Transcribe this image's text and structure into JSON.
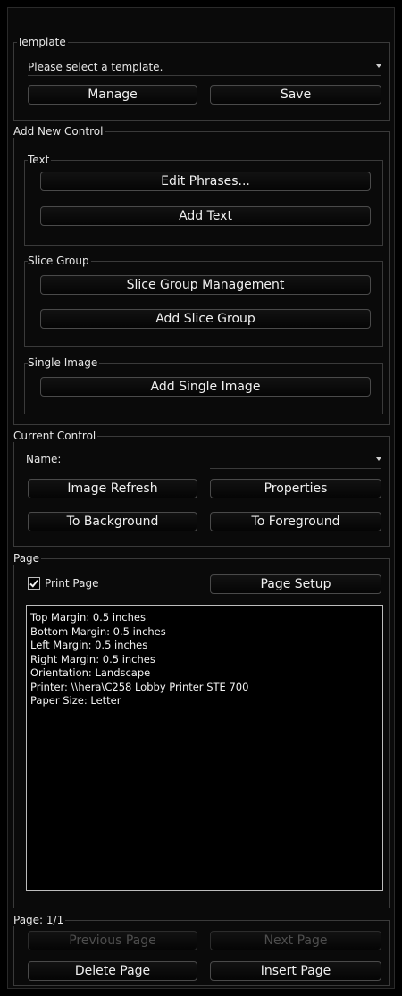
{
  "template": {
    "legend": "Template",
    "select_value": "Please select a template.",
    "manage_label": "Manage",
    "save_label": "Save"
  },
  "add_new_control": {
    "legend": "Add New Control",
    "text": {
      "legend": "Text",
      "edit_phrases_label": "Edit Phrases...",
      "add_text_label": "Add Text"
    },
    "slice_group": {
      "legend": "Slice Group",
      "management_label": "Slice Group Management",
      "add_label": "Add Slice Group"
    },
    "single_image": {
      "legend": "Single Image",
      "add_label": "Add Single Image"
    }
  },
  "current_control": {
    "legend": "Current Control",
    "name_label": "Name:",
    "name_value": "",
    "image_refresh_label": "Image Refresh",
    "properties_label": "Properties",
    "to_background_label": "To Background",
    "to_foreground_label": "To Foreground"
  },
  "page": {
    "legend": "Page",
    "print_page_label": "Print Page",
    "print_page_checked": true,
    "page_setup_label": "Page Setup",
    "settings_lines": [
      "Top Margin: 0.5 inches",
      "Bottom Margin: 0.5 inches",
      "Left Margin: 0.5 inches",
      "Right Margin: 0.5 inches",
      "Orientation: Landscape",
      "Printer: \\\\hera\\C258 Lobby Printer STE 700",
      "Paper Size: Letter"
    ]
  },
  "pagination": {
    "legend": "Page: 1/1",
    "previous_label": "Previous Page",
    "next_label": "Next Page",
    "delete_label": "Delete Page",
    "insert_label": "Insert Page"
  },
  "colors": {
    "background": "#000000",
    "text": "#e8e8e8",
    "disabled_text": "#4e4e4e",
    "border": "#3a3a3a"
  }
}
